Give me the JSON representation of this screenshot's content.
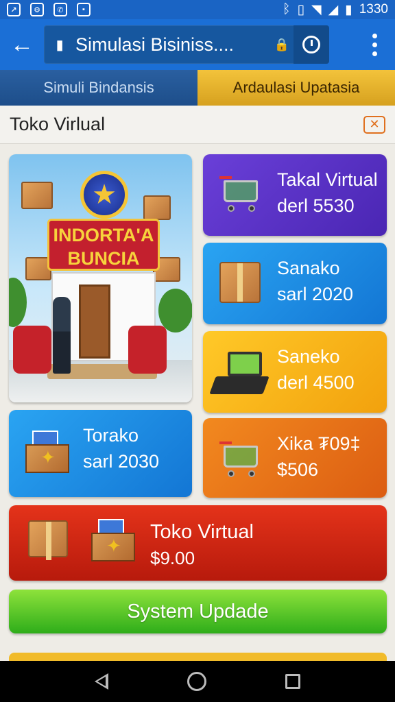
{
  "status_bar": {
    "time": "1330"
  },
  "browser": {
    "page_title": "Simulasi Bisiniss....",
    "icons": [
      "back-arrow-icon",
      "tab-icon",
      "lock-icon",
      "clock-icon",
      "more-vert-icon"
    ]
  },
  "tabs": [
    {
      "label": "Simuli Bindansis"
    },
    {
      "label": "Ardaulasi Upatasia"
    }
  ],
  "header": {
    "title": "Toko Virlual"
  },
  "hero": {
    "sign_line1": "INDORTA'A",
    "sign_line2": "BUNCIA"
  },
  "products": [
    {
      "title": "Takal Virtual",
      "subtitle": "derl 5530",
      "color": "#5a33c9",
      "icon": "shopping-cart-icon"
    },
    {
      "title": "Sanako",
      "subtitle": "sarl  2020",
      "color": "#1e8ce4",
      "icon": "cardboard-box-icon"
    },
    {
      "title": "Saneko",
      "subtitle": "derl  4500",
      "color": "#f7b41b",
      "icon": "laptop-icon"
    },
    {
      "title": "Torako",
      "subtitle": "sarl  2030",
      "color": "#1e8ce4",
      "icon": "open-box-icon"
    },
    {
      "title": "Xika  ₮09‡",
      "subtitle": "$506",
      "color": "#e87419",
      "icon": "shopping-cart-icon"
    }
  ],
  "featured": {
    "title": "Toko Virtual",
    "price": "$9.00",
    "color": "#cf2613"
  },
  "update_button": {
    "label": "System Updade",
    "color": "#4fc425"
  }
}
